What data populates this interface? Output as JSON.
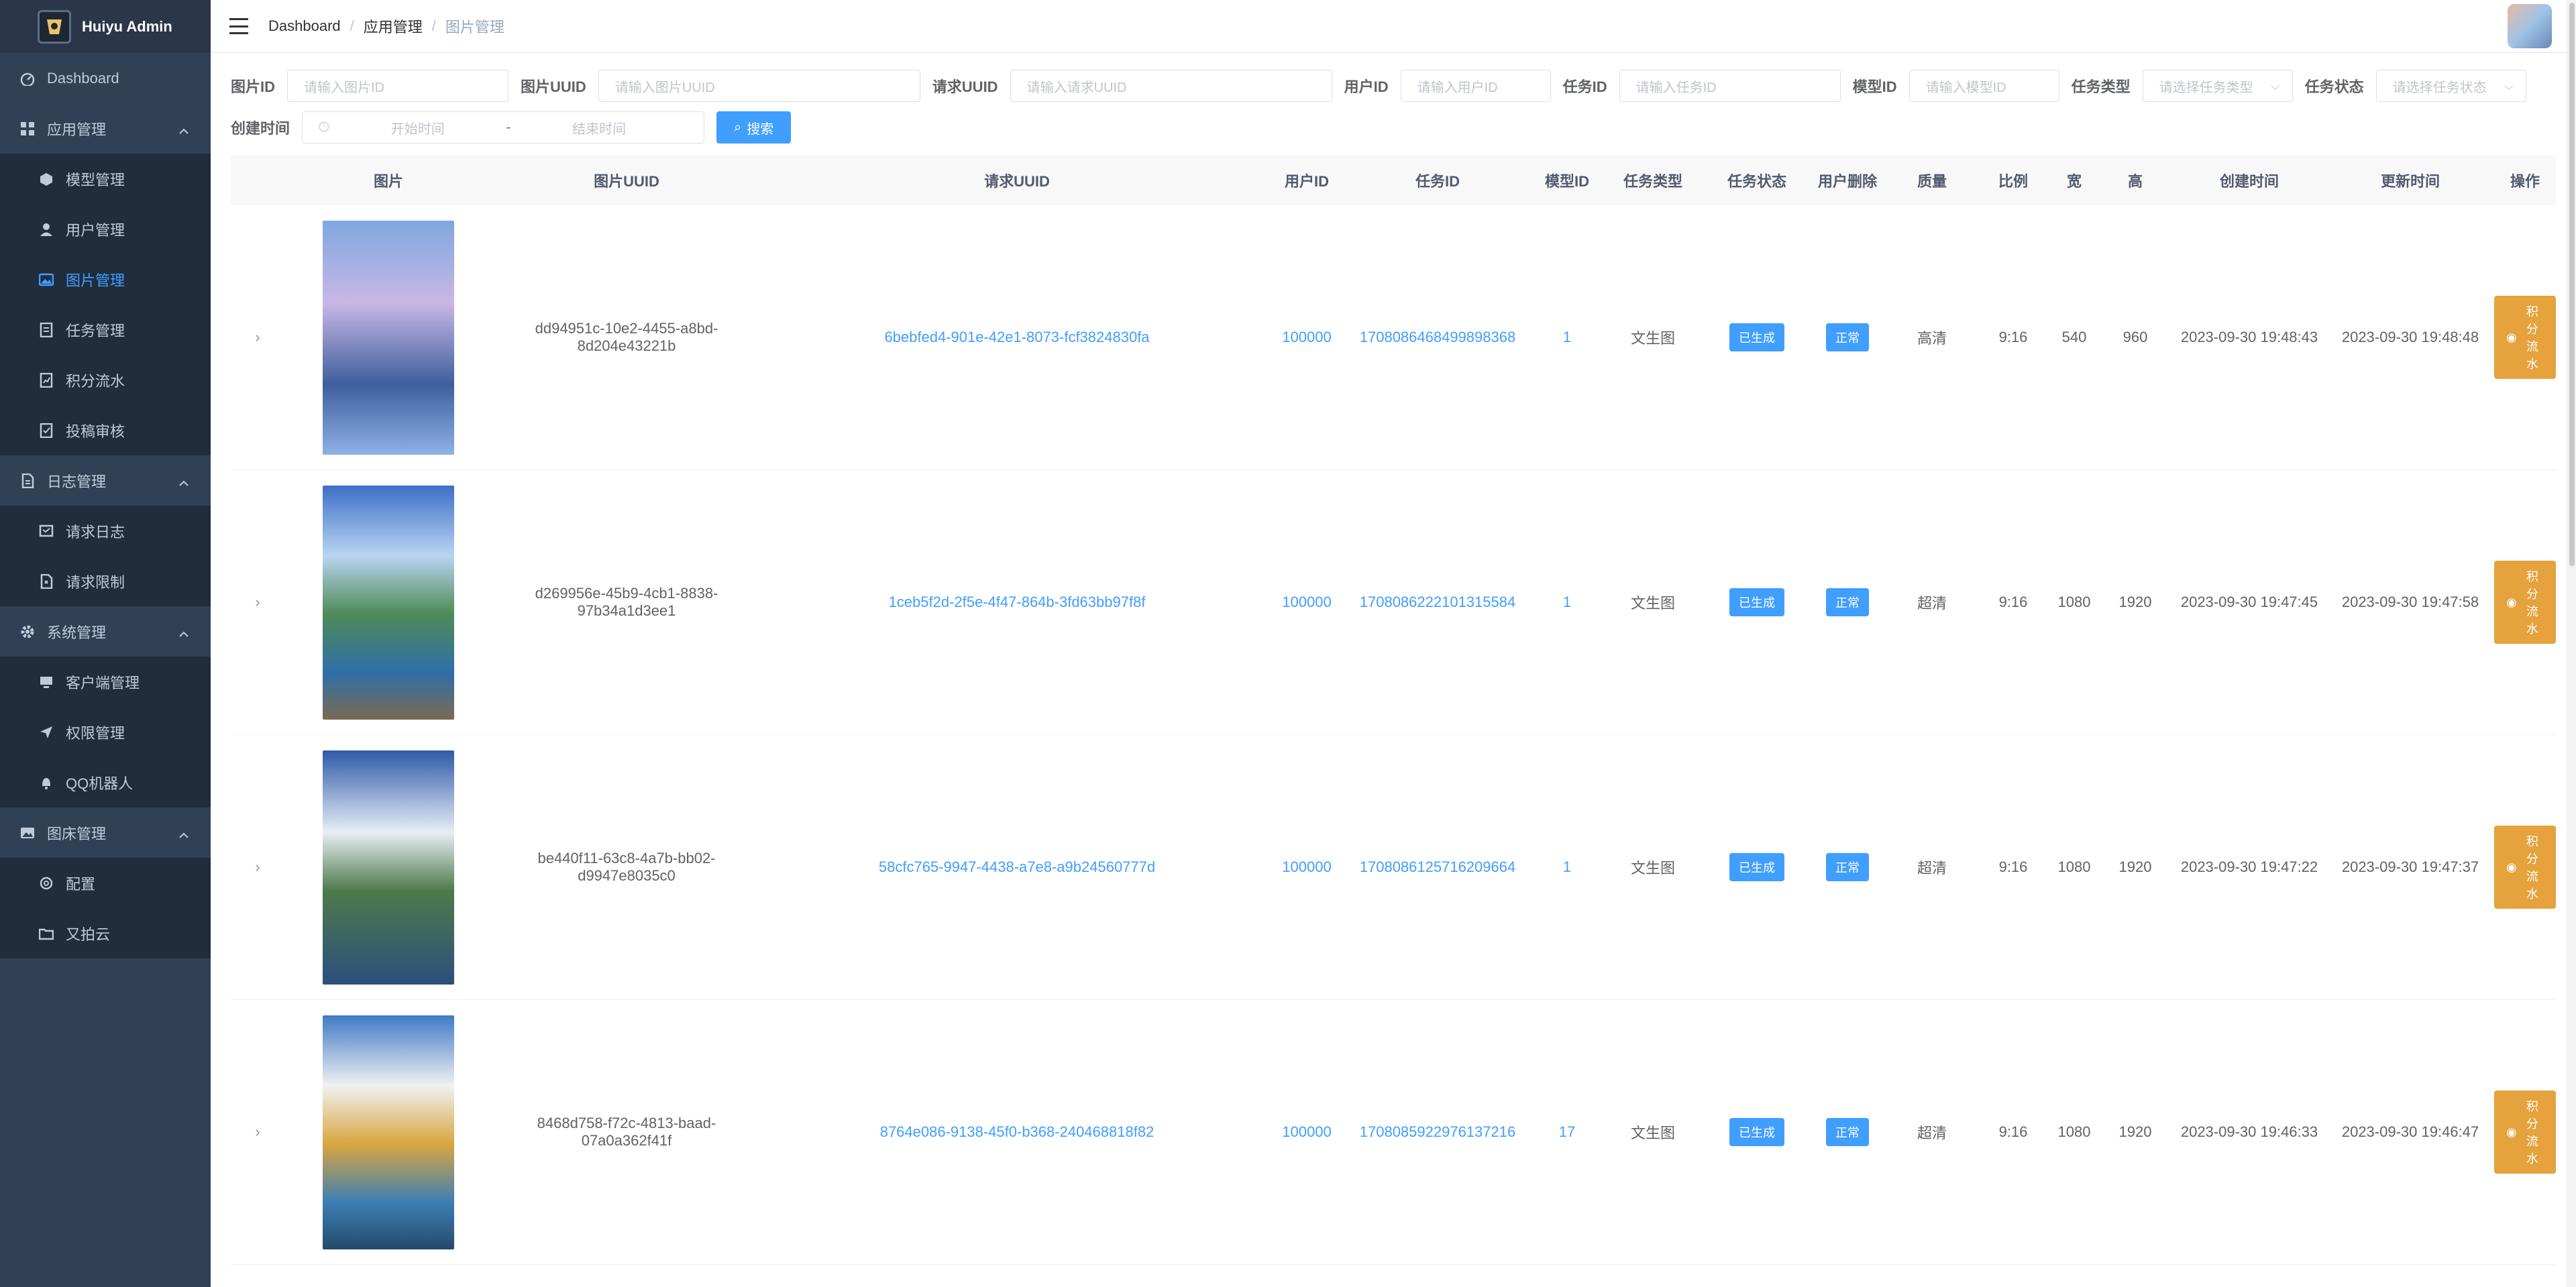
{
  "app": {
    "title": "Huiyu Admin"
  },
  "sidebar": {
    "dashboard": "Dashboard",
    "groups": [
      {
        "label": "应用管理",
        "icon": "grid-icon",
        "items": [
          {
            "label": "模型管理",
            "icon": "cube-icon"
          },
          {
            "label": "用户管理",
            "icon": "user-icon"
          },
          {
            "label": "图片管理",
            "icon": "image-icon",
            "active": true
          },
          {
            "label": "任务管理",
            "icon": "task-icon"
          },
          {
            "label": "积分流水",
            "icon": "points-icon"
          },
          {
            "label": "投稿审核",
            "icon": "review-icon"
          }
        ]
      },
      {
        "label": "日志管理",
        "icon": "log-icon",
        "items": [
          {
            "label": "请求日志",
            "icon": "request-log-icon"
          },
          {
            "label": "请求限制",
            "icon": "limit-icon"
          }
        ]
      },
      {
        "label": "系统管理",
        "icon": "gear-icon",
        "items": [
          {
            "label": "客户端管理",
            "icon": "monitor-icon"
          },
          {
            "label": "权限管理",
            "icon": "send-icon"
          },
          {
            "label": "QQ机器人",
            "icon": "bell-icon"
          }
        ]
      },
      {
        "label": "图床管理",
        "icon": "picture-icon",
        "items": [
          {
            "label": "配置",
            "icon": "config-icon"
          },
          {
            "label": "又拍云",
            "icon": "folder-icon"
          }
        ]
      }
    ]
  },
  "breadcrumb": [
    "Dashboard",
    "应用管理",
    "图片管理"
  ],
  "filters": {
    "image_id": {
      "label": "图片ID",
      "placeholder": "请输入图片ID"
    },
    "image_uuid": {
      "label": "图片UUID",
      "placeholder": "请输入图片UUID"
    },
    "request_uuid": {
      "label": "请求UUID",
      "placeholder": "请输入请求UUID"
    },
    "user_id": {
      "label": "用户ID",
      "placeholder": "请输入用户ID"
    },
    "task_id": {
      "label": "任务ID",
      "placeholder": "请输入任务ID"
    },
    "model_id": {
      "label": "模型ID",
      "placeholder": "请输入模型ID"
    },
    "task_type": {
      "label": "任务类型",
      "placeholder": "请选择任务类型"
    },
    "task_status": {
      "label": "任务状态",
      "placeholder": "请选择任务状态"
    },
    "created": {
      "label": "创建时间",
      "start": "开始时间",
      "sep": "-",
      "end": "结束时间"
    },
    "search_button": "搜索"
  },
  "table": {
    "headers": [
      "图片",
      "图片UUID",
      "请求UUID",
      "用户ID",
      "任务ID",
      "模型ID",
      "任务类型",
      "任务状态",
      "用户删除",
      "质量",
      "比例",
      "宽",
      "高",
      "创建时间",
      "更新时间",
      "操作"
    ],
    "rows": [
      {
        "image_uuid": "dd94951c-10e2-4455-a8bd-8d204e43221b",
        "request_uuid": "6bebfed4-901e-42e1-8073-fcf3824830fa",
        "user_id": "100000",
        "task_id": "1708086468499898368",
        "model_id": "1",
        "task_type": "文生图",
        "status": "已生成",
        "deleted": "正常",
        "quality": "高清",
        "ratio": "9:16",
        "width": "540",
        "height": "960",
        "created": "2023-09-30 19:48:43",
        "updated": "2023-09-30 19:48:48",
        "action": "积分流水"
      },
      {
        "image_uuid": "d269956e-45b9-4cb1-8838-97b34a1d3ee1",
        "request_uuid": "1ceb5f2d-2f5e-4f47-864b-3fd63bb97f8f",
        "user_id": "100000",
        "task_id": "1708086222101315584",
        "model_id": "1",
        "task_type": "文生图",
        "status": "已生成",
        "deleted": "正常",
        "quality": "超清",
        "ratio": "9:16",
        "width": "1080",
        "height": "1920",
        "created": "2023-09-30 19:47:45",
        "updated": "2023-09-30 19:47:58",
        "action": "积分流水"
      },
      {
        "image_uuid": "be440f11-63c8-4a7b-bb02-d9947e8035c0",
        "request_uuid": "58cfc765-9947-4438-a7e8-a9b24560777d",
        "user_id": "100000",
        "task_id": "1708086125716209664",
        "model_id": "1",
        "task_type": "文生图",
        "status": "已生成",
        "deleted": "正常",
        "quality": "超清",
        "ratio": "9:16",
        "width": "1080",
        "height": "1920",
        "created": "2023-09-30 19:47:22",
        "updated": "2023-09-30 19:47:37",
        "action": "积分流水"
      },
      {
        "image_uuid": "8468d758-f72c-4813-baad-07a0a362f41f",
        "request_uuid": "8764e086-9138-45f0-b368-240468818f82",
        "user_id": "100000",
        "task_id": "1708085922976137216",
        "model_id": "17",
        "task_type": "文生图",
        "status": "已生成",
        "deleted": "正常",
        "quality": "超清",
        "ratio": "9:16",
        "width": "1080",
        "height": "1920",
        "created": "2023-09-30 19:46:33",
        "updated": "2023-09-30 19:46:47",
        "action": "积分流水"
      }
    ]
  },
  "colors": {
    "sidebar_bg": "#304156",
    "submenu_bg": "#1f2d3d",
    "primary": "#409eff",
    "warning": "#e6a23c"
  }
}
